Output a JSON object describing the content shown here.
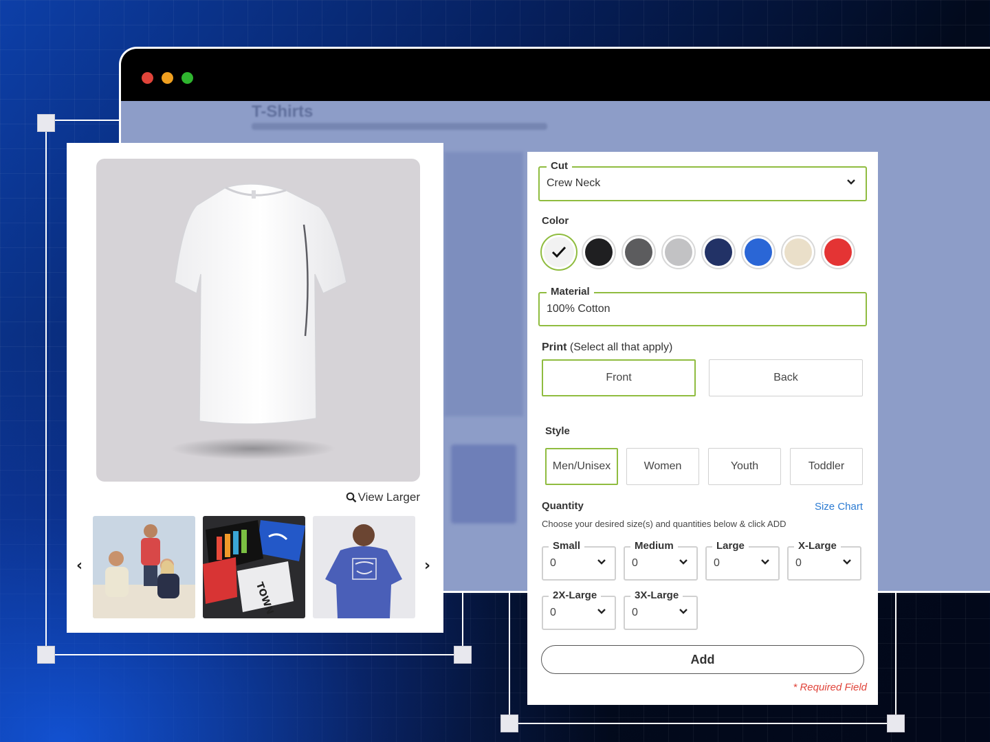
{
  "page": {
    "title": "T-Shirts"
  },
  "window": {
    "dots": [
      {
        "name": "close",
        "color": "#e0443a"
      },
      {
        "name": "minimize",
        "color": "#f0a020"
      },
      {
        "name": "maximize",
        "color": "#2fb52f"
      }
    ]
  },
  "product": {
    "view_larger": "View Larger",
    "thumbnails": [
      {
        "name": "family-lifestyle-photo"
      },
      {
        "name": "folded-shirts-photo"
      },
      {
        "name": "man-blue-shirt-photo"
      }
    ]
  },
  "form": {
    "cut": {
      "label": "Cut",
      "value": "Crew Neck"
    },
    "color": {
      "label": "Color",
      "selected_index": 0,
      "swatches": [
        "#f2f2f2",
        "#1f1f21",
        "#5c5c5e",
        "#c2c2c4",
        "#223266",
        "#2a66d6",
        "#eadfc9",
        "#e43434"
      ]
    },
    "material": {
      "label": "Material",
      "value": "100% Cotton"
    },
    "print": {
      "label": "Print",
      "hint": "(Select all that apply)",
      "options": [
        {
          "label": "Front",
          "selected": true
        },
        {
          "label": "Back",
          "selected": false
        }
      ]
    },
    "style": {
      "label": "Style",
      "options": [
        {
          "label": "Men/Unisex",
          "selected": true
        },
        {
          "label": "Women",
          "selected": false
        },
        {
          "label": "Youth",
          "selected": false
        },
        {
          "label": "Toddler",
          "selected": false
        }
      ]
    },
    "quantity": {
      "label": "Quantity",
      "size_chart": "Size Chart",
      "instructions": "Choose your desired size(s) and quantities below & click ADD",
      "sizes": [
        {
          "label": "Small",
          "value": "0"
        },
        {
          "label": "Medium",
          "value": "0"
        },
        {
          "label": "Large",
          "value": "0"
        },
        {
          "label": "X-Large",
          "value": "0"
        },
        {
          "label": "2X-Large",
          "value": "0"
        },
        {
          "label": "3X-Large",
          "value": "0"
        }
      ]
    },
    "add_label": "Add",
    "required_note": "* Required Field"
  },
  "colors": {
    "accent_green": "#8fbc3f",
    "link_blue": "#2a7ad2",
    "required_red": "#e0443a"
  }
}
